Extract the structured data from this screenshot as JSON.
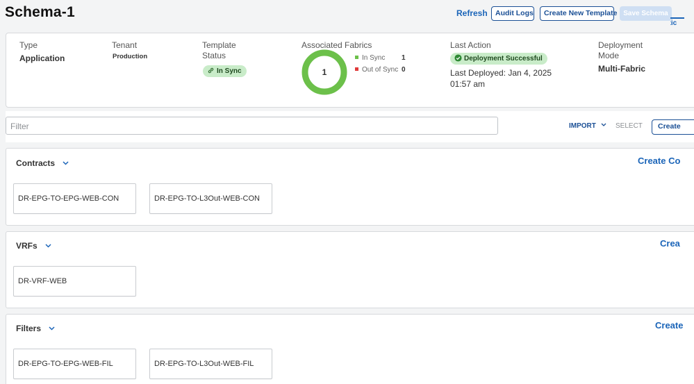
{
  "header": {
    "title": "Schema-1",
    "refresh_label": "Refresh",
    "audit_logs_label": "Audit Logs",
    "create_template_label": "Create New Template",
    "save_schema_label": "Save Schema",
    "tab_partial": "ctic"
  },
  "summary": {
    "type_label": "Type",
    "type_value": "Application",
    "tenant_label": "Tenant",
    "tenant_value": "Production",
    "template_status_label": "Template Status",
    "template_status_value": "In Sync",
    "associated_fabrics_label": "Associated Fabrics",
    "fabrics_total": "1",
    "fabrics_in_sync": 1,
    "fabrics_out_of_sync": 0,
    "legend": [
      {
        "label": "In Sync",
        "count": "1",
        "color": "#6cc04a"
      },
      {
        "label": "Out of Sync",
        "count": "0",
        "color": "#e03a3a"
      }
    ],
    "last_action_label": "Last Action",
    "last_action_value": "Deployment Successful",
    "last_deployed": "Last Deployed: Jan 4, 2025 01:57 am",
    "deployment_mode_label": "Deployment Mode",
    "deployment_mode_value": "Multi-Fabric"
  },
  "filterbar": {
    "filter_placeholder": "Filter",
    "import_label": "IMPORT",
    "select_label": "SELECT",
    "create_label": "Create"
  },
  "sections": {
    "contracts": {
      "title": "Contracts",
      "create_label": "Create Co",
      "items": [
        "DR-EPG-TO-EPG-WEB-CON",
        "DR-EPG-TO-L3Out-WEB-CON"
      ]
    },
    "vrfs": {
      "title": "VRFs",
      "create_label": "Crea",
      "items": [
        "DR-VRF-WEB"
      ]
    },
    "filters": {
      "title": "Filters",
      "create_label": "Create",
      "items": [
        "DR-EPG-TO-EPG-WEB-FIL",
        "DR-EPG-TO-L3Out-WEB-FIL"
      ]
    }
  },
  "colors": {
    "accent": "#1a64b8",
    "in_sync_green": "#6cc04a",
    "pill_bg": "#c9ecc9",
    "out_of_sync_red": "#e03a3a"
  }
}
